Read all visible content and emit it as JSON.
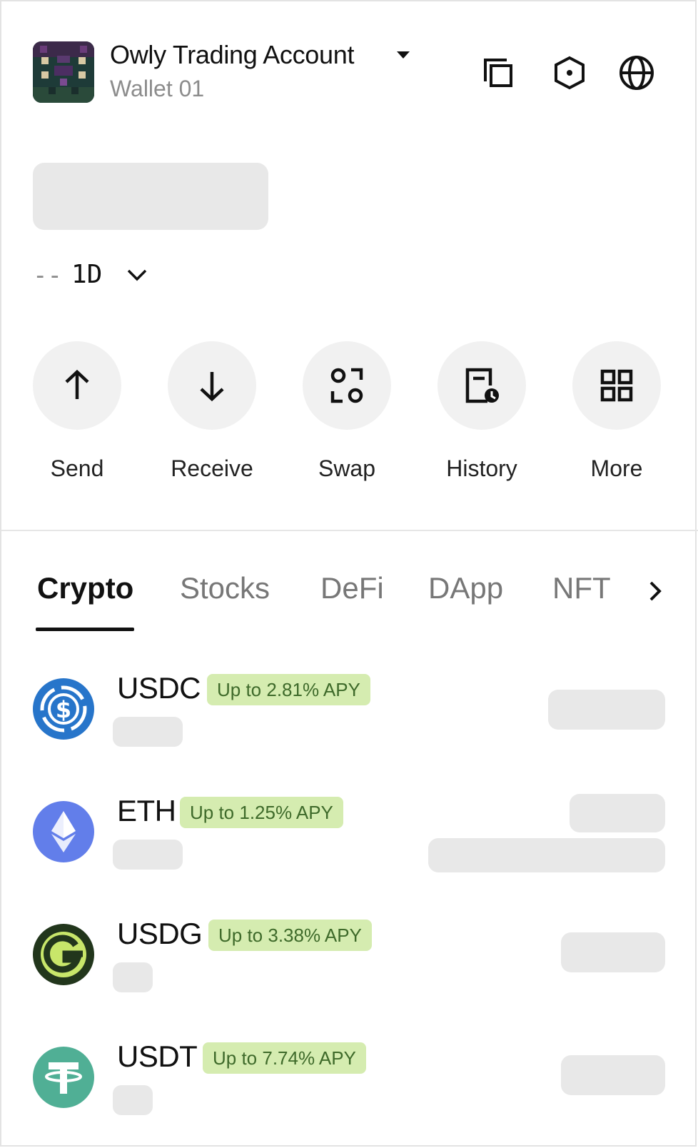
{
  "header": {
    "account_name": "Owly Trading Account",
    "wallet_name": "Wallet 01",
    "icons": [
      "copy-icon",
      "hexagon-settings-icon",
      "globe-icon"
    ]
  },
  "balance": {
    "change_placeholder": "--",
    "period": "1D"
  },
  "actions": [
    {
      "label": "Send",
      "icon": "arrow-up-icon"
    },
    {
      "label": "Receive",
      "icon": "arrow-down-icon"
    },
    {
      "label": "Swap",
      "icon": "swap-icon"
    },
    {
      "label": "History",
      "icon": "history-icon"
    },
    {
      "label": "More",
      "icon": "grid-icon"
    }
  ],
  "tabs": [
    {
      "label": "Crypto",
      "active": true
    },
    {
      "label": "Stocks",
      "active": false
    },
    {
      "label": "DeFi",
      "active": false
    },
    {
      "label": "DApp",
      "active": false
    },
    {
      "label": "NFT",
      "active": false
    }
  ],
  "assets": [
    {
      "symbol": "USDC",
      "apy": "Up to 2.81% APY",
      "icon": "usdc-icon",
      "color": "#2775ca"
    },
    {
      "symbol": "ETH",
      "apy": "Up to 1.25% APY",
      "icon": "eth-icon",
      "color": "#627eea"
    },
    {
      "symbol": "USDG",
      "apy": "Up to 3.38% APY",
      "icon": "usdg-icon",
      "color": "#22361c"
    },
    {
      "symbol": "USDT",
      "apy": "Up to 7.74% APY",
      "icon": "usdt-icon",
      "color": "#50af95"
    }
  ],
  "colors": {
    "apy_badge_bg": "#d5ecb0",
    "apy_badge_text": "#3e6a2a",
    "skeleton": "#e8e8e8",
    "action_bg": "#f1f1f1"
  }
}
